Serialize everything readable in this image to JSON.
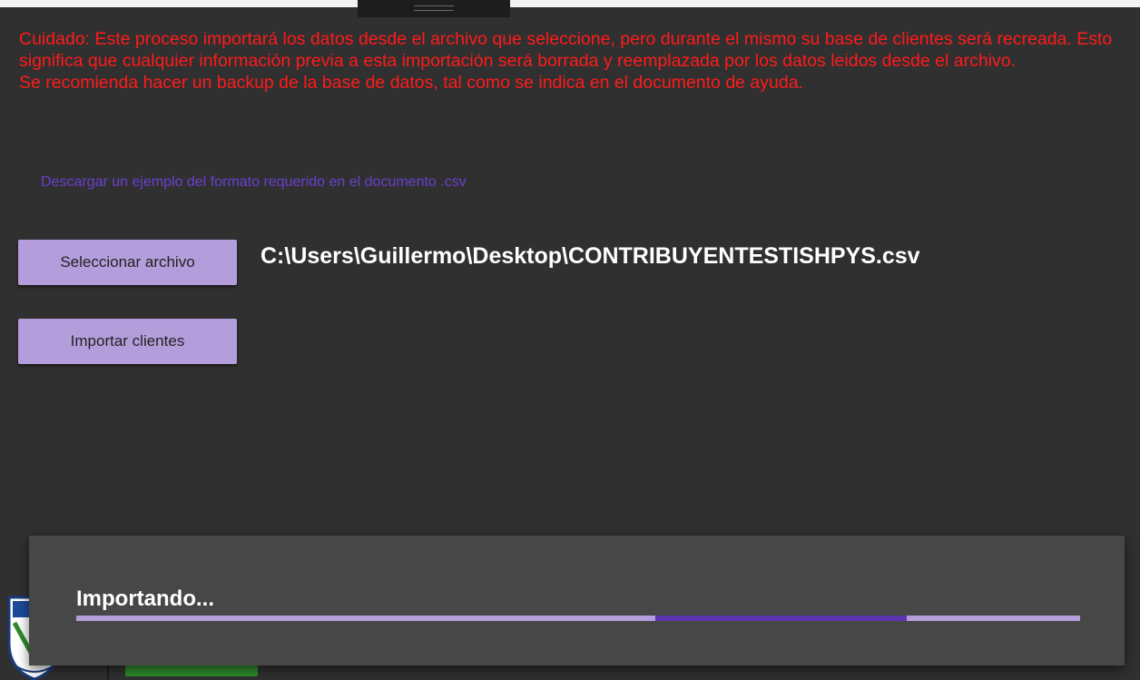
{
  "warning": {
    "line1": "Cuidado: Este proceso importará los datos desde el archivo que seleccione, pero durante el mismo su base de clientes será recreada. Esto significa que cualquier información previa a esta importación será borrada y reemplazada por los datos leidos desde el archivo.",
    "line2": "Se recomienda hacer un backup de la base de datos, tal como se indica en el documento de ayuda."
  },
  "download_link": "Descargar un ejemplo del formato requerido en el documento .csv",
  "buttons": {
    "select_file": "Seleccionar archivo",
    "import_clients": "Importar clientes"
  },
  "selected_file_path": "C:\\Users\\Guillermo\\Desktop\\CONTRIBUYENTESTISHPYS.csv",
  "snackbar": {
    "message": "Importando...",
    "progress_mode": "indeterminate"
  },
  "colors": {
    "background": "#303030",
    "warning_text": "#ff1a1a",
    "link_text": "#6a3fcf",
    "button_bg": "#b39ddb",
    "snackbar_bg": "#474747",
    "progress_track": "#b39ddb",
    "progress_indicator": "#5e35b1"
  }
}
